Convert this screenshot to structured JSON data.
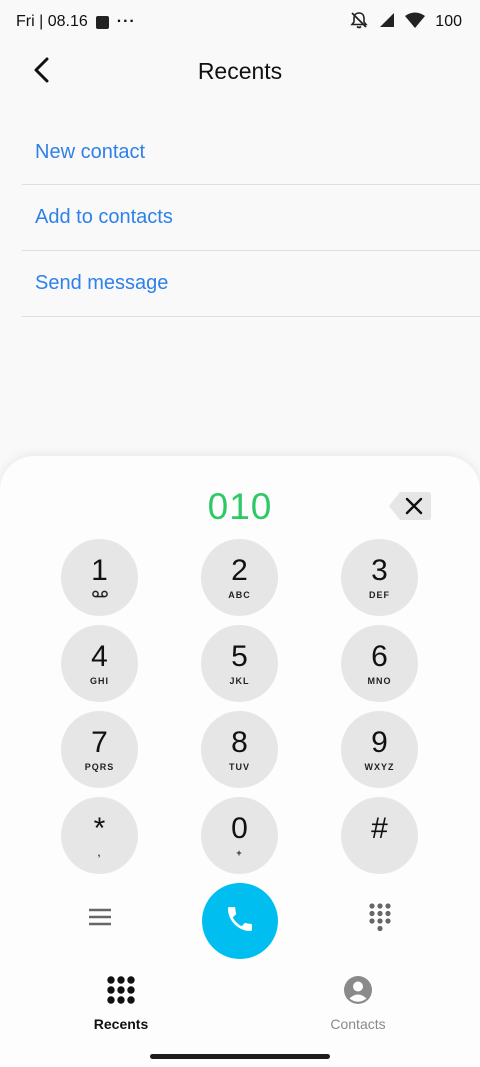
{
  "status_bar": {
    "time": "Fri | 08.16",
    "more": "···",
    "battery": "100"
  },
  "header": {
    "title": "Recents"
  },
  "actions": [
    {
      "label": "New contact"
    },
    {
      "label": "Add to contacts"
    },
    {
      "label": "Send message"
    }
  ],
  "dialpad": {
    "number": "010",
    "keys": [
      {
        "digit": "1",
        "letters": ""
      },
      {
        "digit": "2",
        "letters": "ABC"
      },
      {
        "digit": "3",
        "letters": "DEF"
      },
      {
        "digit": "4",
        "letters": "GHI"
      },
      {
        "digit": "5",
        "letters": "JKL"
      },
      {
        "digit": "6",
        "letters": "MNO"
      },
      {
        "digit": "7",
        "letters": "PQRS"
      },
      {
        "digit": "8",
        "letters": "TUV"
      },
      {
        "digit": "9",
        "letters": "WXYZ"
      },
      {
        "digit": "*",
        "letters": ","
      },
      {
        "digit": "0",
        "letters": "+"
      },
      {
        "digit": "#",
        "letters": ""
      }
    ]
  },
  "bottom_nav": {
    "recents_label": "Recents",
    "contacts_label": "Contacts"
  },
  "colors": {
    "accent_blue": "#2f80e8",
    "number_green": "#2ec866",
    "call_button": "#00bff0",
    "key_background": "#e6e6e6"
  },
  "icons": {
    "back": "chevron-left-icon",
    "backspace": "backspace-icon",
    "voicemail": "voicemail-icon",
    "menu": "menu-icon",
    "call": "phone-icon",
    "keypad": "keypad-icon",
    "recents_tab": "keypad-grid-icon",
    "contacts_tab": "person-icon"
  }
}
